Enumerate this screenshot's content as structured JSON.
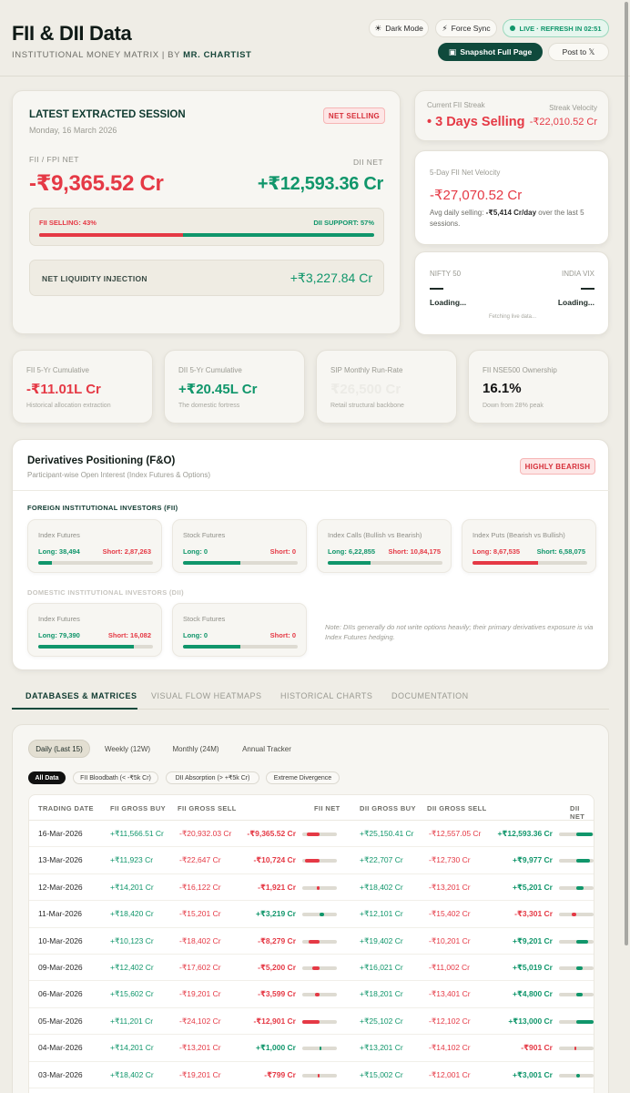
{
  "header": {
    "title": "FII & DII Data",
    "subtitle": "INSTITUTIONAL MONEY MATRIX | BY",
    "author": "MR. CHARTIST",
    "dark_mode": "Dark Mode",
    "force_sync": "Force Sync",
    "live": "LIVE · REFRESH IN 02:51",
    "snapshot": "Snapshot Full Page",
    "post": "Post to 𝕏"
  },
  "session": {
    "title": "LATEST EXTRACTED SESSION",
    "date": "Monday, 16 March 2026",
    "badge": "NET SELLING",
    "fii_label": "FII / FPI NET",
    "fii_value": "-₹9,365.52 Cr",
    "dii_label": "DII NET",
    "dii_value": "+₹12,593.36 Cr",
    "fii_selling": "FII SELLING: 43%",
    "dii_support": "DII SUPPORT: 57%",
    "fii_selling_pct": 43,
    "liquidity_label": "NET LIQUIDITY INJECTION",
    "liquidity_value": "+₹3,227.84 Cr"
  },
  "streak": {
    "label": "Current FII Streak",
    "value": "3 Days Selling",
    "velocity_label": "Streak Velocity",
    "velocity_value": "-₹22,010.52 Cr"
  },
  "velocity": {
    "label": "5-Day FII Net Velocity",
    "value": "-₹27,070.52 Cr",
    "note_prefix": "Avg daily selling: ",
    "note_bold": "-₹5,414 Cr/day",
    "note_suffix": " over the last 5 sessions."
  },
  "market": {
    "nifty_label": "NIFTY 50",
    "nifty_status": "Loading...",
    "vix_label": "INDIA VIX",
    "vix_status": "Loading...",
    "footer": "Fetching live data..."
  },
  "stats": [
    {
      "label": "FII 5-Yr Cumulative",
      "value": "-₹11.01L Cr",
      "sub": "Historical allocation extraction",
      "color": "#e53945"
    },
    {
      "label": "DII 5-Yr Cumulative",
      "value": "+₹20.45L Cr",
      "sub": "The domestic fortress",
      "color": "#10966b"
    },
    {
      "label": "SIP Monthly Run-Rate",
      "value": "₹26,500 Cr",
      "sub": "Retail structural backbone",
      "color": "#ecebe6"
    },
    {
      "label": "FII NSE500 Ownership",
      "value": "16.1%",
      "sub": "Down from 28% peak",
      "color": "#111111"
    }
  ],
  "derivatives": {
    "title": "Derivatives Positioning (F&O)",
    "subtitle": "Participant-wise Open Interest (Index Futures & Options)",
    "badge": "HIGHLY BEARISH",
    "fii_group": "FOREIGN INSTITUTIONAL INVESTORS (FII)",
    "dii_group": "DOMESTIC INSTITUTIONAL INVESTORS (DII)",
    "fii_cards": [
      {
        "label": "Index Futures",
        "left_label": "Long: 38,494",
        "right_label": "Short: 2,87,263",
        "fill": 12,
        "color": "#10966b",
        "left_color": "#10966b",
        "right_color": "#e53945"
      },
      {
        "label": "Stock Futures",
        "left_label": "Long: 0",
        "right_label": "Short: 0",
        "fill": 50,
        "color": "#10966b",
        "left_color": "#10966b",
        "right_color": "#e53945"
      },
      {
        "label": "Index Calls (Bullish vs Bearish)",
        "left_label": "Long: 6,22,855",
        "right_label": "Short: 10,84,175",
        "fill": 37,
        "color": "#10966b",
        "left_color": "#10966b",
        "right_color": "#e53945"
      },
      {
        "label": "Index Puts (Bearish vs Bullish)",
        "left_label": "Long: 8,67,535",
        "right_label": "Short: 6,58,075",
        "fill": 57,
        "color": "#e53945",
        "left_color": "#e53945",
        "right_color": "#10966b"
      }
    ],
    "dii_cards": [
      {
        "label": "Index Futures",
        "left_label": "Long: 79,390",
        "right_label": "Short: 16,082",
        "fill": 83,
        "color": "#10966b",
        "left_color": "#10966b",
        "right_color": "#e53945"
      },
      {
        "label": "Stock Futures",
        "left_label": "Long: 0",
        "right_label": "Short: 0",
        "fill": 50,
        "color": "#10966b",
        "left_color": "#10966b",
        "right_color": "#e53945"
      }
    ],
    "note": "Note: DIIs generally do not write options heavily; their primary derivatives exposure is via Index Futures hedging."
  },
  "tabs": [
    "DATABASES & MATRICES",
    "VISUAL FLOW HEATMAPS",
    "HISTORICAL CHARTS",
    "DOCUMENTATION"
  ],
  "periods": [
    "Daily (Last 15)",
    "Weekly (12W)",
    "Monthly (24M)",
    "Annual Tracker"
  ],
  "filters": [
    "All Data",
    "FII Bloodbath (< -₹5k Cr)",
    "DII Absorption (> +₹5k Cr)",
    "Extreme Divergence"
  ],
  "table": {
    "headers": [
      "TRADING DATE",
      "FII GROSS BUY",
      "FII GROSS SELL",
      "FII NET",
      "DII GROSS BUY",
      "DII GROSS SELL",
      "DII NET"
    ],
    "rows": [
      {
        "date": "16-Mar-2026",
        "fii_buy": "+₹11,566.51 Cr",
        "fii_sell": "-₹20,932.03 Cr",
        "fii_net": "-₹9,365.52 Cr",
        "fii_net_val": -9365.52,
        "dii_buy": "+₹25,150.41 Cr",
        "dii_sell": "-₹12,557.05 Cr",
        "dii_net": "+₹12,593.36 Cr",
        "dii_net_val": 12593.36
      },
      {
        "date": "13-Mar-2026",
        "fii_buy": "+₹11,923 Cr",
        "fii_sell": "-₹22,647 Cr",
        "fii_net": "-₹10,724 Cr",
        "fii_net_val": -10724,
        "dii_buy": "+₹22,707 Cr",
        "dii_sell": "-₹12,730 Cr",
        "dii_net": "+₹9,977 Cr",
        "dii_net_val": 9977
      },
      {
        "date": "12-Mar-2026",
        "fii_buy": "+₹14,201 Cr",
        "fii_sell": "-₹16,122 Cr",
        "fii_net": "-₹1,921 Cr",
        "fii_net_val": -1921,
        "dii_buy": "+₹18,402 Cr",
        "dii_sell": "-₹13,201 Cr",
        "dii_net": "+₹5,201 Cr",
        "dii_net_val": 5201
      },
      {
        "date": "11-Mar-2026",
        "fii_buy": "+₹18,420 Cr",
        "fii_sell": "-₹15,201 Cr",
        "fii_net": "+₹3,219 Cr",
        "fii_net_val": 3219,
        "dii_buy": "+₹12,101 Cr",
        "dii_sell": "-₹15,402 Cr",
        "dii_net": "-₹3,301 Cr",
        "dii_net_val": -3301
      },
      {
        "date": "10-Mar-2026",
        "fii_buy": "+₹10,123 Cr",
        "fii_sell": "-₹18,402 Cr",
        "fii_net": "-₹8,279 Cr",
        "fii_net_val": -8279,
        "dii_buy": "+₹19,402 Cr",
        "dii_sell": "-₹10,201 Cr",
        "dii_net": "+₹9,201 Cr",
        "dii_net_val": 9201
      },
      {
        "date": "09-Mar-2026",
        "fii_buy": "+₹12,402 Cr",
        "fii_sell": "-₹17,602 Cr",
        "fii_net": "-₹5,200 Cr",
        "fii_net_val": -5200,
        "dii_buy": "+₹16,021 Cr",
        "dii_sell": "-₹11,002 Cr",
        "dii_net": "+₹5,019 Cr",
        "dii_net_val": 5019
      },
      {
        "date": "06-Mar-2026",
        "fii_buy": "+₹15,602 Cr",
        "fii_sell": "-₹19,201 Cr",
        "fii_net": "-₹3,599 Cr",
        "fii_net_val": -3599,
        "dii_buy": "+₹18,201 Cr",
        "dii_sell": "-₹13,401 Cr",
        "dii_net": "+₹4,800 Cr",
        "dii_net_val": 4800
      },
      {
        "date": "05-Mar-2026",
        "fii_buy": "+₹11,201 Cr",
        "fii_sell": "-₹24,102 Cr",
        "fii_net": "-₹12,901 Cr",
        "fii_net_val": -12901,
        "dii_buy": "+₹25,102 Cr",
        "dii_sell": "-₹12,102 Cr",
        "dii_net": "+₹13,000 Cr",
        "dii_net_val": 13000
      },
      {
        "date": "04-Mar-2026",
        "fii_buy": "+₹14,201 Cr",
        "fii_sell": "-₹13,201 Cr",
        "fii_net": "+₹1,000 Cr",
        "fii_net_val": 1000,
        "dii_buy": "+₹13,201 Cr",
        "dii_sell": "-₹14,102 Cr",
        "dii_net": "-₹901 Cr",
        "dii_net_val": -901
      },
      {
        "date": "03-Mar-2026",
        "fii_buy": "+₹18,402 Cr",
        "fii_sell": "-₹19,201 Cr",
        "fii_net": "-₹799 Cr",
        "fii_net_val": -799,
        "dii_buy": "+₹15,002 Cr",
        "dii_sell": "-₹12,001 Cr",
        "dii_net": "+₹3,001 Cr",
        "dii_net_val": 3001
      }
    ]
  }
}
